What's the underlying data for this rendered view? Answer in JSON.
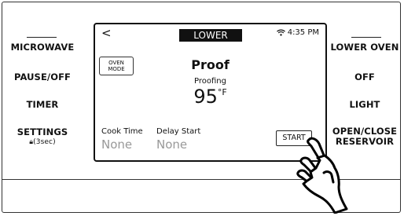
{
  "left_buttons": {
    "microwave": "MICROWAVE",
    "pause_off": "PAUSE/OFF",
    "timer": "TIMER",
    "settings": "SETTINGS",
    "settings_hint": "(3sec)"
  },
  "right_buttons": {
    "lower_oven": "LOWER OVEN",
    "off": "OFF",
    "light": "LIGHT",
    "open_close_line1": "OPEN/CLOSE",
    "open_close_line2": "RESERVOIR"
  },
  "screen": {
    "back_glyph": "<",
    "oven_tab": "LOWER",
    "time": "4:35 PM",
    "mode_line1": "OVEN",
    "mode_line2": "MODE",
    "title": "Proof",
    "subtitle": "Proofing",
    "temperature": "95",
    "temperature_unit": "°F",
    "cook_time_label": "Cook Time",
    "cook_time_value": "None",
    "delay_start_label": "Delay Start",
    "delay_start_value": "None",
    "start_label": "START"
  },
  "icons": {
    "wifi": "wifi-icon",
    "lock": "lock-icon",
    "hand": "pointing-hand-icon"
  }
}
